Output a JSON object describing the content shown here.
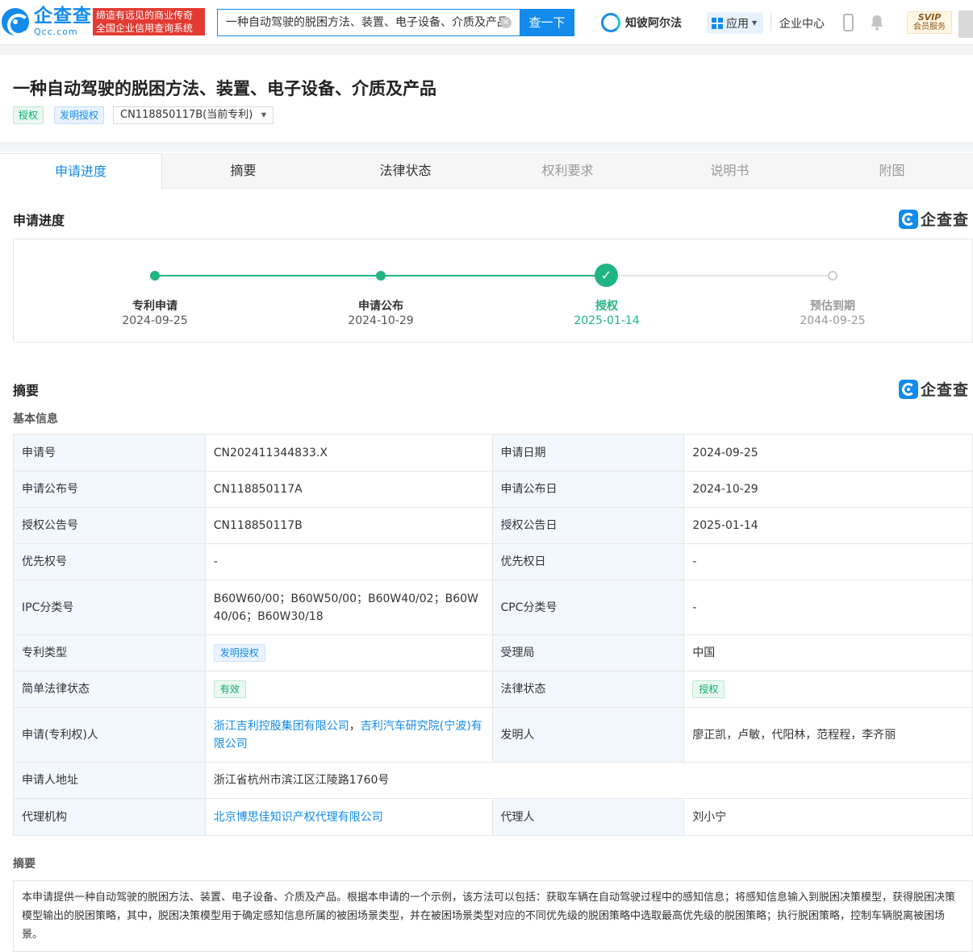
{
  "header": {
    "logo_cn": "企查查",
    "logo_en": "Qcc.com",
    "slogan_line1": "缔造有远见的商业传奇",
    "slogan_line2": "全国企业信用查询系统",
    "search_value": "一种自动驾驶的脱困方法、装置、电子设备、介质及产品",
    "search_button": "查一下",
    "zhibi": "知彼阿尔法",
    "apps": "应用",
    "enterprise_center": "企业中心",
    "svip": "SVIP",
    "svip_sub": "会员服务"
  },
  "patent": {
    "title": "一种自动驾驶的脱困方法、装置、电子设备、介质及产品",
    "tag_status": "授权",
    "tag_type": "发明授权",
    "current_patent": "CN118850117B(当前专利)"
  },
  "tabs": [
    {
      "label": "申请进度"
    },
    {
      "label": "摘要"
    },
    {
      "label": "法律状态"
    },
    {
      "label": "权利要求"
    },
    {
      "label": "说明书"
    },
    {
      "label": "附图"
    }
  ],
  "progress": {
    "title": "申请进度",
    "brand": "企查查",
    "steps": [
      {
        "label": "专利申请",
        "date": "2024-09-25"
      },
      {
        "label": "申请公布",
        "date": "2024-10-29"
      },
      {
        "label": "授权",
        "date": "2025-01-14"
      },
      {
        "label": "预估到期",
        "date": "2044-09-25"
      }
    ]
  },
  "summary": {
    "title": "摘要",
    "brand": "企查查",
    "basic_info": "基本信息",
    "rows": [
      {
        "k1": "申请号",
        "v1": "CN202411344833.X",
        "k2": "申请日期",
        "v2": "2024-09-25"
      },
      {
        "k1": "申请公布号",
        "v1": "CN118850117A",
        "k2": "申请公布日",
        "v2": "2024-10-29"
      },
      {
        "k1": "授权公告号",
        "v1": "CN118850117B",
        "k2": "授权公告日",
        "v2": "2025-01-14"
      },
      {
        "k1": "优先权号",
        "v1": "-",
        "k2": "优先权日",
        "v2": "-"
      },
      {
        "k1": "IPC分类号",
        "v1": "B60W60/00；B60W50/00；B60W40/02；B60W40/06；B60W30/18",
        "k2": "CPC分类号",
        "v2": "-"
      },
      {
        "k1": "专利类型",
        "v1": "发明授权",
        "k2": "受理局",
        "v2": "中国"
      },
      {
        "k1": "简单法律状态",
        "v1": "有效",
        "k2": "法律状态",
        "v2": "授权"
      },
      {
        "k1": "申请(专利权)人",
        "v1a": "浙江吉利控股集团有限公司",
        "v1sep": "，",
        "v1b": "吉利汽车研究院(宁波)有限公司",
        "k2": "发明人",
        "v2": "廖正凯，卢敏，代阳林，范程程，李齐丽"
      },
      {
        "k1": "申请人地址",
        "v1": "浙江省杭州市滨江区江陵路1760号"
      },
      {
        "k1": "代理机构",
        "v1": "北京博思佳知识产权代理有限公司",
        "k2": "代理人",
        "v2": "刘小宁"
      }
    ],
    "abstract_label": "摘要",
    "abstract_text": "本申请提供一种自动驾驶的脱困方法、装置、电子设备、介质及产品。根据本申请的一个示例，该方法可以包括：获取车辆在自动驾驶过程中的感知信息；将感知信息输入到脱困决策模型，获得脱困决策模型输出的脱困策略，其中，脱困决策模型用于确定感知信息所属的被困场景类型，并在被困场景类型对应的不同优先级的脱困策略中选取最高优先级的脱困策略；执行脱困策略，控制车辆脱离被困场景。"
  },
  "colors": {
    "brand": "#128bed",
    "success": "#1fb480",
    "slogan_bg": "#e33a32"
  }
}
